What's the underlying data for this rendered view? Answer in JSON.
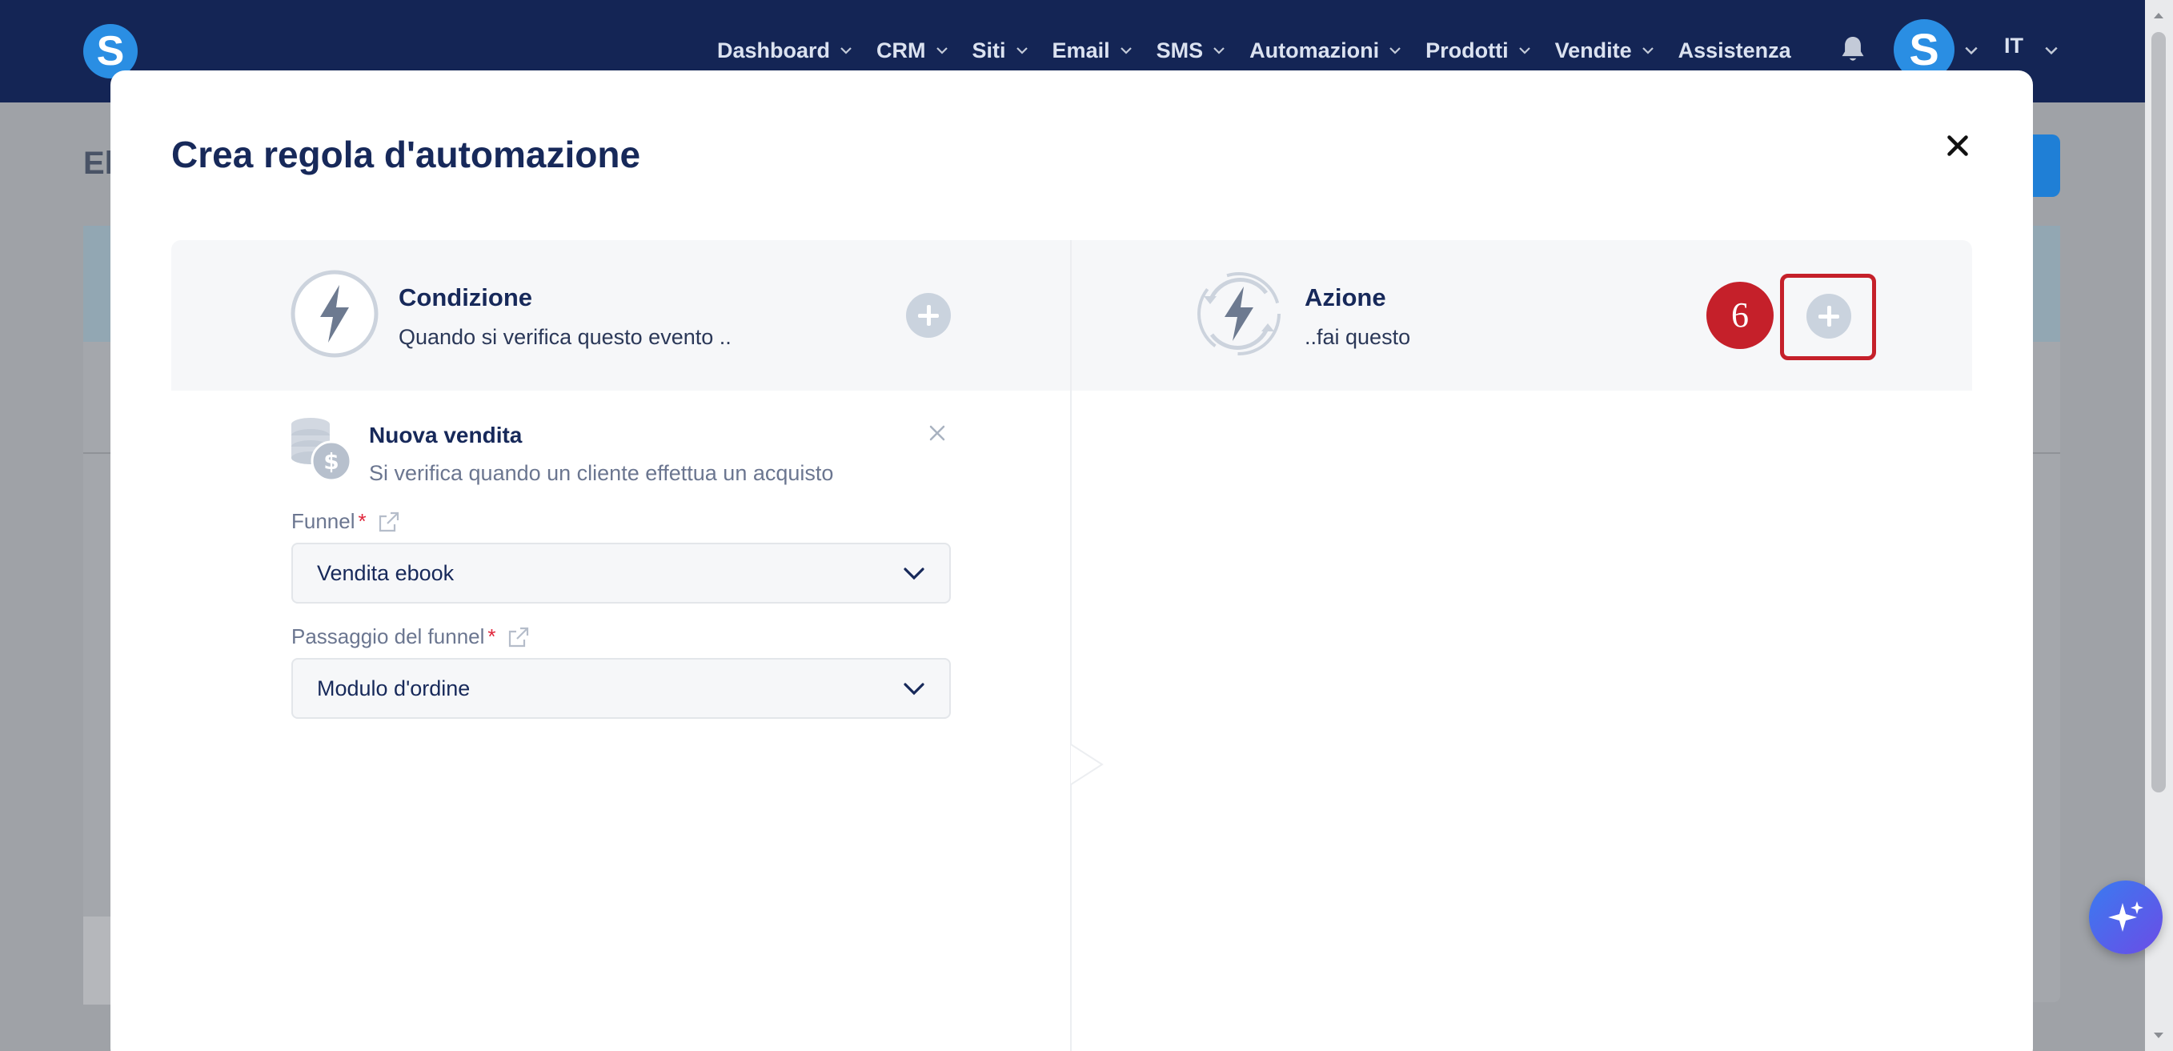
{
  "navbar": {
    "logo_letter": "S",
    "items": [
      {
        "label": "Dashboard",
        "has_dropdown": true
      },
      {
        "label": "CRM",
        "has_dropdown": true
      },
      {
        "label": "Siti",
        "has_dropdown": true
      },
      {
        "label": "Email",
        "has_dropdown": true
      },
      {
        "label": "SMS",
        "has_dropdown": true
      },
      {
        "label": "Automazioni",
        "has_dropdown": true
      },
      {
        "label": "Prodotti",
        "has_dropdown": true
      },
      {
        "label": "Vendite",
        "has_dropdown": true
      },
      {
        "label": "Assistenza",
        "has_dropdown": false
      }
    ],
    "avatar_letter": "S",
    "language": "IT",
    "icons": [
      "bell-icon",
      "chevron-down-icon"
    ]
  },
  "background": {
    "page_title": "El"
  },
  "modal": {
    "title": "Crea regola d'automazione",
    "close_icon": "close-icon",
    "condition": {
      "title": "Condizione",
      "subtitle": "Quando si verifica questo evento .."
    },
    "action": {
      "title": "Azione",
      "subtitle": "..fai questo"
    },
    "step_badge": "6",
    "trigger": {
      "title": "Nuova vendita",
      "subtitle": "Si verifica quando un cliente effettua un acquisto",
      "icon": "coins-dollar-icon"
    },
    "funnel": {
      "label": "Funnel",
      "required_mark": "*",
      "value": "Vendita ebook"
    },
    "funnel_step": {
      "label": "Passaggio del funnel",
      "required_mark": "*",
      "value": "Modulo d'ordine"
    }
  },
  "colors": {
    "navbar_bg": "#142555",
    "brand_blue": "#2a8ee3",
    "title_navy": "#17295a",
    "highlight_red": "#c5202a",
    "plus_button": "#cad3de"
  }
}
